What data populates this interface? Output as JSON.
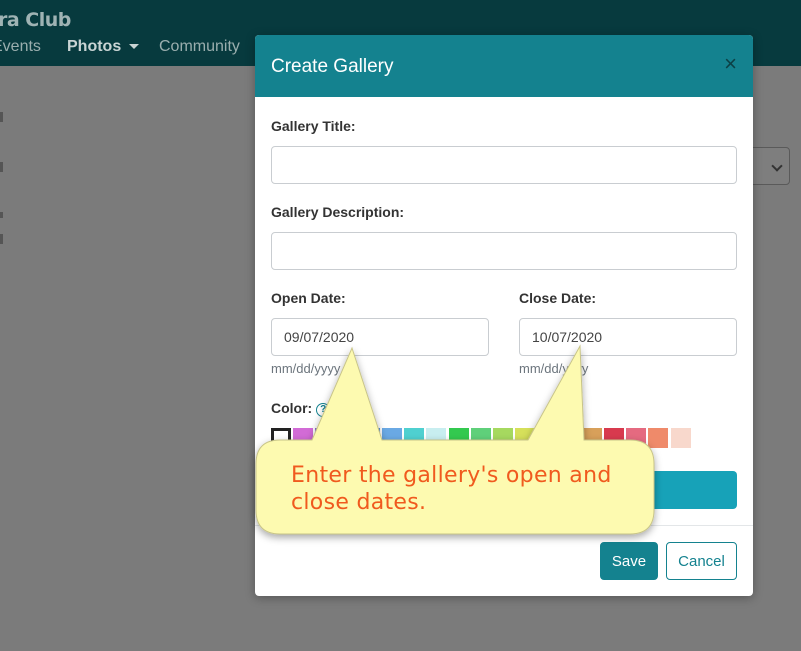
{
  "navbar": {
    "brand": "ra Club",
    "items": [
      {
        "label": "Events",
        "active": false
      },
      {
        "label": "Photos",
        "active": true
      },
      {
        "label": "Community",
        "active": false
      }
    ]
  },
  "modal": {
    "title": "Create Gallery",
    "close_glyph": "×",
    "gallery_title_label": "Gallery Title:",
    "gallery_title_value": "",
    "gallery_description_label": "Gallery Description:",
    "gallery_description_value": "",
    "open_date_label": "Open Date:",
    "open_date_value": "09/07/2020",
    "open_date_hint": "mm/dd/yyyy",
    "close_date_label": "Close Date:",
    "close_date_value": "10/07/2020",
    "close_date_hint": "mm/dd/yyyy",
    "color_label": "Color:",
    "color_help_glyph": "?",
    "swatches": [
      "#ffffff",
      "#d26bd6",
      "#8d6fd1",
      "#6c7fd8",
      "#5b8fdc",
      "#6aa9e4",
      "#4fd0d0",
      "#c8eef0",
      "#33c94f",
      "#5fd07a",
      "#a6d95f",
      "#d6e05a",
      "#e8c84a",
      "#e0b05a",
      "#d8a05a",
      "#d83a4e",
      "#e56a80",
      "#ef8a6a",
      "#f8d8cc"
    ],
    "selected_swatch": 0,
    "save_label": "Save",
    "cancel_label": "Cancel"
  },
  "tooltip": {
    "text_line1": "Enter the gallery's open and",
    "text_line2": "close dates.",
    "fill": "#fdfab0",
    "text_color": "#f05a1e"
  }
}
